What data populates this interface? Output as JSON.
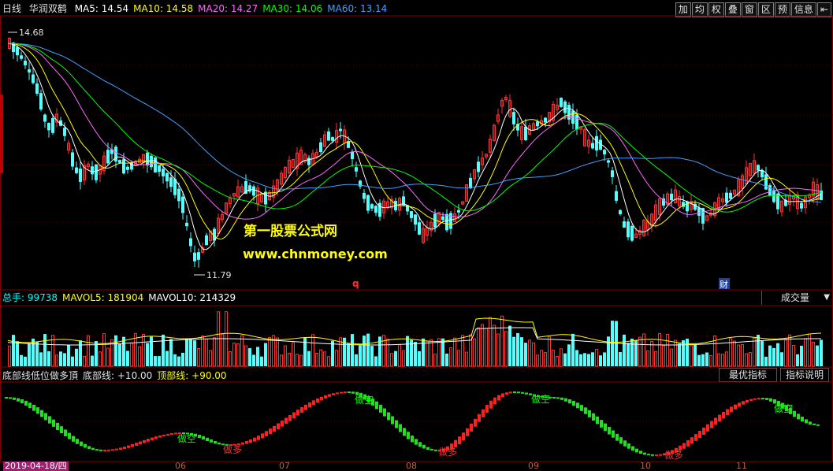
{
  "window": {
    "period": "日线",
    "stock_name": "华润双鹤"
  },
  "ma_legend": [
    {
      "label": "MA5: 14.54",
      "color": "#ffffff"
    },
    {
      "label": "MA10: 14.58",
      "color": "#ffff00"
    },
    {
      "label": "MA20: 14.27",
      "color": "#ff66ff"
    },
    {
      "label": "MA30: 14.06",
      "color": "#00ff00"
    },
    {
      "label": "MA60: 13.14",
      "color": "#40a0ff"
    }
  ],
  "toolbar": [
    "加",
    "均",
    "权",
    "叠",
    "窗",
    "区",
    "预",
    "信息"
  ],
  "toolbar_back": "⇤",
  "price_panel": {
    "high_label": "14.68",
    "low_label": "11.79",
    "marker_q": "q",
    "marker_cai": "财"
  },
  "volume_panel": {
    "legend": [
      {
        "label": "总手: 99738",
        "color": "#00ffff"
      },
      {
        "label": "MAVOL5: 181904",
        "color": "#ffff00"
      },
      {
        "label": "MAVOL10: 214329",
        "color": "#ffffff"
      }
    ],
    "selector": "成交量",
    "selector_arrow": "▼"
  },
  "indicator_panel": {
    "legend": [
      {
        "label": "底部线低位做多頂",
        "color": "#e0e0e0"
      },
      {
        "label": "底部线: +10.00",
        "color": "#e0e0e0"
      },
      {
        "label": "顶部线: +90.00",
        "color": "#ffff00"
      }
    ],
    "btn_best": "最优指标",
    "btn_explain": "指标说明",
    "signals": [
      {
        "text": "做空",
        "color": "#00ff00"
      },
      {
        "text": "做多",
        "color": "#ff3030"
      },
      {
        "text": "做空",
        "color": "#00ff00"
      },
      {
        "text": "做多",
        "color": "#ff3030"
      },
      {
        "text": "做空",
        "color": "#00ff00"
      },
      {
        "text": "做多",
        "color": "#ff3030"
      },
      {
        "text": "做空",
        "color": "#00ff00"
      }
    ]
  },
  "date_axis": {
    "current": "2019-04-18/四",
    "months": [
      "06",
      "07",
      "08",
      "09",
      "10",
      "11"
    ]
  },
  "watermark": {
    "line1": "第一股票公式网",
    "line2": "www.chnmoney.com"
  },
  "colors": {
    "up": "#ff3232",
    "down": "#54ffff",
    "ma5": "#ffffff",
    "ma10": "#ffff00",
    "ma20": "#ff66ff",
    "ma30": "#00ff00",
    "ma60": "#40a0ff"
  },
  "chart_data": {
    "type": "candlestick",
    "y_range": [
      11.79,
      14.68
    ],
    "high": 14.68,
    "low": 11.79,
    "ma_values": {
      "MA5": 14.54,
      "MA10": 14.58,
      "MA20": 14.27,
      "MA30": 14.06,
      "MA60": 13.14
    },
    "volume_last": 99738,
    "mavol5": 181904,
    "mavol10": 214329,
    "indicator_bottom": 10,
    "indicator_top": 90
  }
}
